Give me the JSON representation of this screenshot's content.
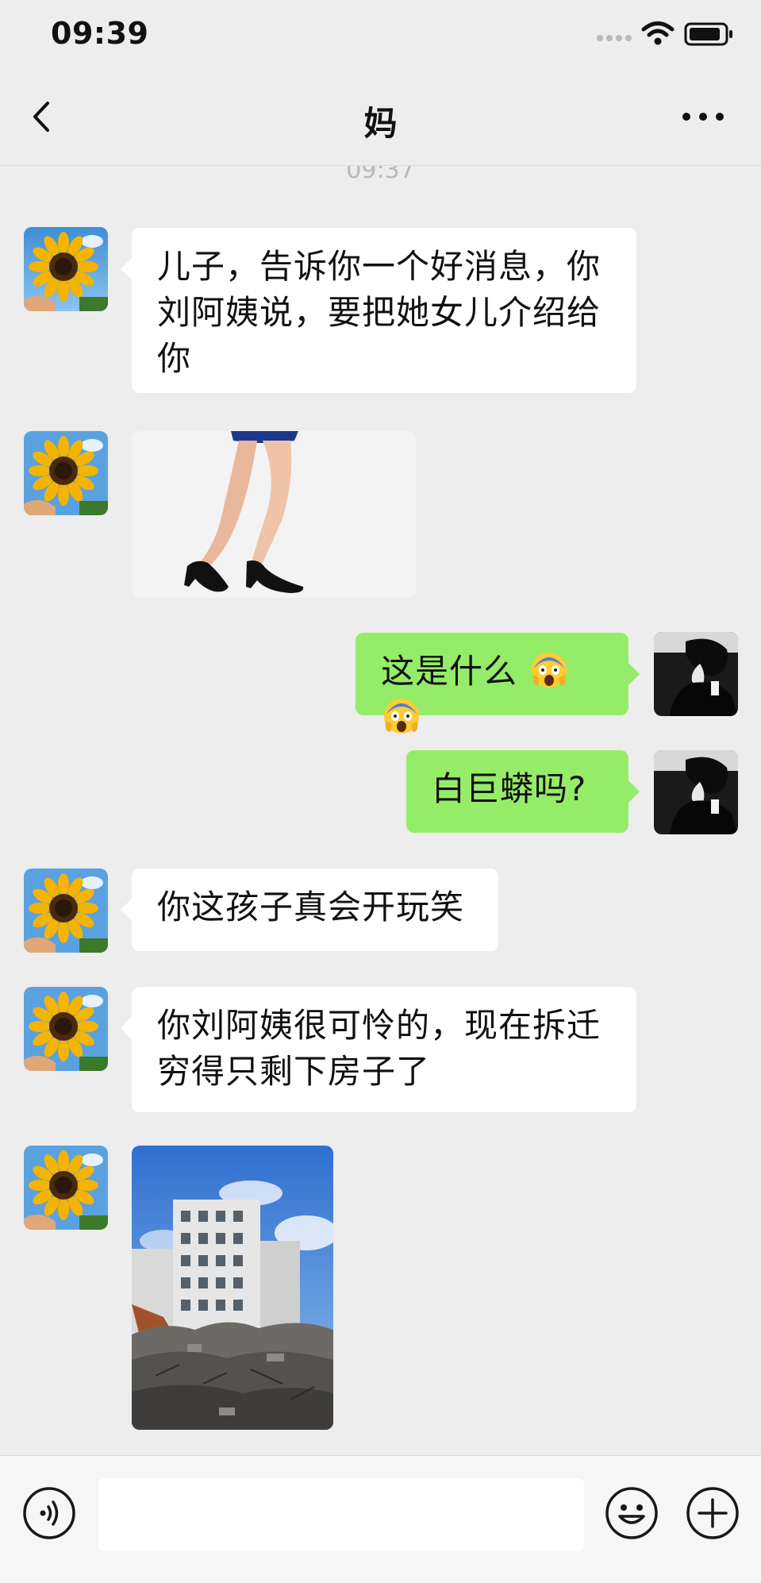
{
  "status_bar": {
    "time": "09:39"
  },
  "header": {
    "title": "妈",
    "back_icon": "chevron-left-icon",
    "more_icon": "ellipsis-icon"
  },
  "chat": {
    "timestamp": "09:37",
    "messages": [
      {
        "side": "in",
        "type": "text",
        "text": "儿子，告诉你一个好消息，你刘阿姨说，要把她女儿介绍给你"
      },
      {
        "side": "in",
        "type": "image"
      },
      {
        "side": "out",
        "type": "text",
        "text": "这是什么",
        "emojis": [
          "scream-emoji",
          "scream-emoji"
        ]
      },
      {
        "side": "out",
        "type": "text",
        "text": "白巨蟒吗?"
      },
      {
        "side": "in",
        "type": "text",
        "text": "你这孩子真会开玩笑"
      },
      {
        "side": "in",
        "type": "text",
        "text": "你刘阿姨很可怜的，现在拆迁穷得只剩下房子了"
      },
      {
        "side": "in",
        "type": "image"
      }
    ],
    "line_breaks": {
      "msg0": [
        "儿子，告诉你一个好消息，你",
        "刘阿姨说，要把她女儿介绍给",
        "你"
      ],
      "msg5": [
        "你刘阿姨很可怜的，现在拆迁",
        "穷得只剩下房子了"
      ]
    }
  },
  "input_bar": {
    "placeholder": "",
    "voice_icon": "voice-icon",
    "emoji_icon": "smiley-icon",
    "plus_icon": "plus-icon"
  },
  "colors": {
    "background": "#ededed",
    "incoming_bubble": "#ffffff",
    "outgoing_bubble": "#95ec69"
  }
}
